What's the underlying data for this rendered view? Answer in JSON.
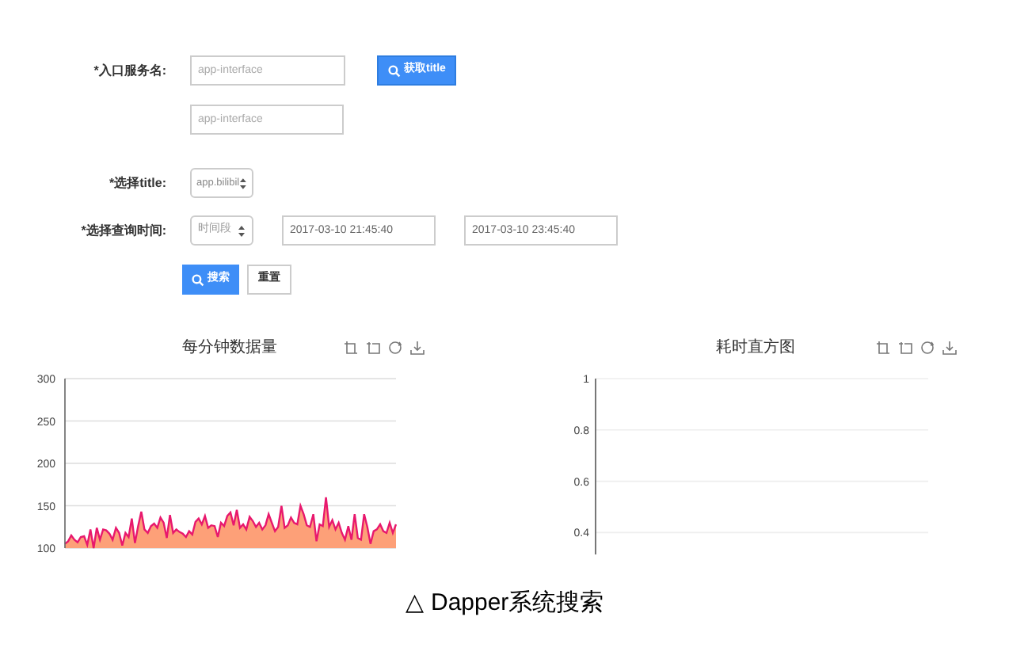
{
  "form": {
    "service": {
      "label": "*入口服务名:",
      "placeholder": "app-interface",
      "button": "获取title"
    },
    "service_echo": {
      "placeholder": "app-interface"
    },
    "title_select": {
      "label": "*选择title:",
      "value": "app.bilibil"
    },
    "time": {
      "label": "*选择查询时间:",
      "mode": "时间段",
      "start": "2017-03-10 21:45:40",
      "end": "2017-03-10 23:45:40"
    },
    "actions": {
      "search": "搜索",
      "reset": "重置"
    }
  },
  "charts": [
    {
      "chart_data": {
        "type": "area",
        "title": "每分钟数据量",
        "ylim": [
          100,
          300
        ],
        "yticks": [
          100,
          150,
          200,
          250,
          300
        ],
        "grid": true,
        "series": [
          {
            "color": "#e8186d",
            "values": [
              105,
              108,
              115,
              110,
              107,
              113,
              114,
              104,
              122,
              100,
              124,
              110,
              122,
              121,
              117,
              110,
              124,
              118,
              103,
              118,
              113,
              135,
              106,
              126,
              143,
              122,
              118,
              126,
              129,
              124,
              136,
              130,
              112,
              139,
              118,
              122,
              119,
              117,
              113,
              120,
              116,
              131,
              135,
              128,
              138,
              124,
              127,
              126,
              113,
              130,
              126,
              138,
              142,
              127,
              145,
              124,
              128,
              122,
              137,
              132,
              125,
              130,
              122,
              127,
              140,
              130,
              120,
              125,
              150,
              124,
              127,
              136,
              130,
              128,
              150,
              140,
              127,
              125,
              140,
              108,
              128,
              126,
              160,
              125,
              133,
              122,
              130,
              118,
              110,
              126,
              110,
              140,
              112,
              110,
              140,
              125,
              105,
              120,
              122,
              128,
              120,
              118,
              130,
              118,
              128
            ]
          }
        ]
      }
    },
    {
      "kind": "empty_panel",
      "title": "耗时直方图",
      "tick_labels": [
        "1",
        "0.8",
        "0.6",
        "0.4"
      ]
    }
  ],
  "caption": "△ Dapper系统搜索"
}
